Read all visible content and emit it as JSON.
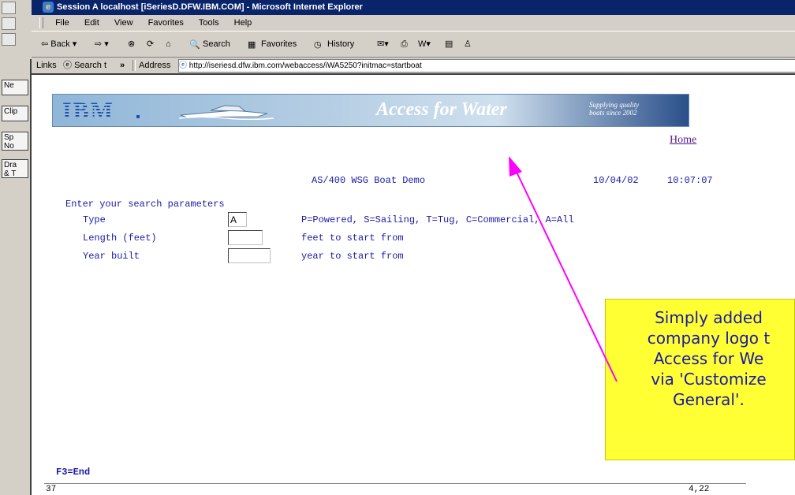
{
  "window": {
    "title": "Session A localhost [iSeriesD.DFW.IBM.COM] - Microsoft Internet Explorer"
  },
  "menu": [
    "File",
    "Edit",
    "View",
    "Favorites",
    "Tools",
    "Help"
  ],
  "toolbar": {
    "back": "Back",
    "search": "Search",
    "favorites": "Favorites",
    "history": "History"
  },
  "links_bar": {
    "links": "Links",
    "search_link": "Search t",
    "chevron": "»",
    "address_label": "Address",
    "url": "http://iseriesd.dfw.ibm.com/webaccess/iWA5250?initmac=startboat"
  },
  "sidebar": {
    "buttons": [
      "Ne",
      "Clip",
      "Sp\nNo",
      "Dra\n& T"
    ]
  },
  "banner": {
    "logo": "IBM",
    "title": "Access for Water",
    "tagline_line1": "Supplying quality",
    "tagline_line2": "boats since 2002"
  },
  "home_link": "Home",
  "screen": {
    "app_title": "AS/400 WSG Boat Demo",
    "date": "10/04/02",
    "time": "10:07:07",
    "heading": "Enter your search parameters",
    "fields": [
      {
        "label": "Type",
        "value": "A",
        "hint": "P=Powered, S=Sailing, T=Tug, C=Commercial, A=All"
      },
      {
        "label": "Length (feet)",
        "value": "",
        "hint": "feet to start from"
      },
      {
        "label": "Year built",
        "value": "",
        "hint": "year to start from"
      }
    ],
    "function_key": "F3=End",
    "status_left": "37",
    "status_right": "4,22"
  },
  "callout": {
    "lines": [
      "Simply added",
      "company logo t",
      "Access for We",
      "via 'Customize",
      "General'."
    ],
    "color": "#ffff33",
    "arrow_color": "#ff00ff"
  }
}
